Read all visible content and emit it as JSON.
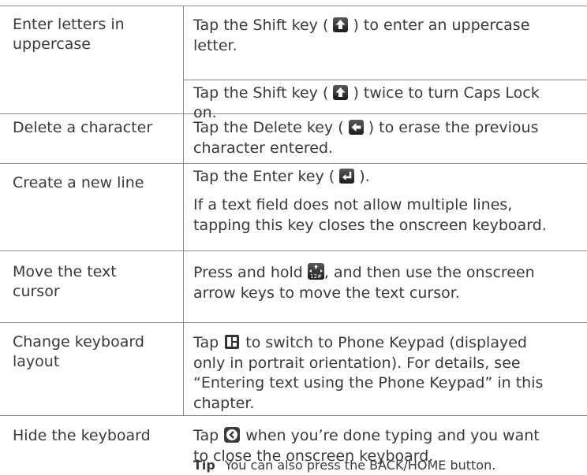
{
  "rows": [
    {
      "label": [
        "Enter letters in",
        "uppercase"
      ],
      "lines": [
        {
          "pre": "Tap the ",
          "key": "Shift",
          "mid": " key ( ",
          "post": " ) to enter an uppercase"
        },
        {
          "text": "letter."
        },
        {
          "pre": "Tap the ",
          "key": "Shift",
          "mid": " key ( ",
          "post": " ) twice to turn Caps Lock"
        },
        {
          "text": "on."
        }
      ]
    },
    {
      "label": [
        "Delete a character"
      ],
      "lines": [
        {
          "pre": "Tap the ",
          "key": "Delete",
          "mid": " key ( ",
          "post": " ) to erase the previous"
        },
        {
          "text": "character entered."
        }
      ]
    },
    {
      "label": [
        "Create a new line"
      ],
      "lines": [
        {
          "pre": "Tap the ",
          "key": "Enter",
          "mid": " key ( ",
          "post": " )."
        },
        {
          "text": "If a text field does not allow multiple lines,"
        },
        {
          "text": "tapping this key closes the onscreen keyboard."
        }
      ]
    },
    {
      "label": [
        "Move the text",
        "cursor"
      ],
      "lines": [
        {
          "pre": "Press and hold ",
          "post": ", and then use the onscreen"
        },
        {
          "text": "arrow keys to move the text cursor."
        }
      ]
    },
    {
      "label": [
        "Change keyboard",
        "layout"
      ],
      "lines": [
        {
          "pre": "Tap ",
          "post": " to switch to Phone Keypad (displayed"
        },
        {
          "text": "only in portrait orientation). For details, see"
        },
        {
          "text": "“Entering text using the Phone Keypad” in this"
        },
        {
          "text": "chapter."
        }
      ]
    },
    {
      "label": [
        "Hide the keyboard"
      ],
      "lines": [
        {
          "pre": "Tap ",
          "post": " when you’re done typing and you want"
        },
        {
          "text": "to close the onscreen keyboard."
        }
      ],
      "tip": {
        "label": "Tip",
        "text": "You can also press the BACK/HOME button."
      }
    }
  ],
  "icons": [
    "shift-key-icon",
    "delete-key-icon",
    "enter-key-icon",
    "cursor-key-icon",
    "keyboard-layout-icon",
    "hide-keyboard-icon"
  ]
}
